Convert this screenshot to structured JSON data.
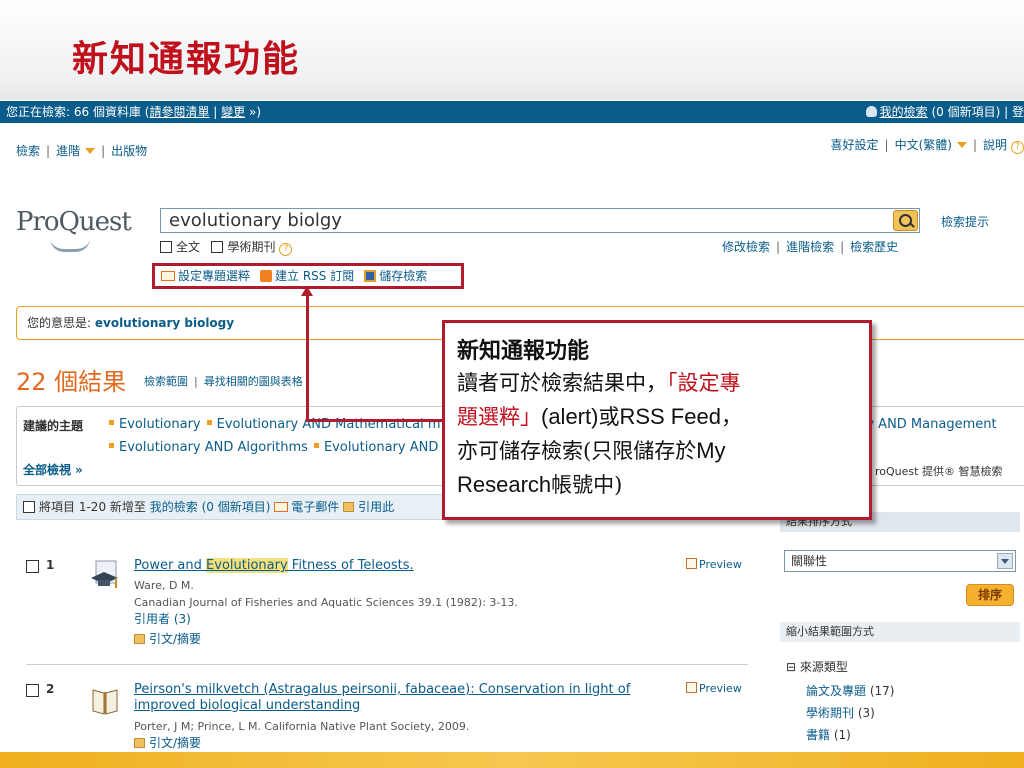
{
  "slide": {
    "title": "新知通報功能"
  },
  "status": {
    "searching": "您正在檢索: 66 個資料庫 (",
    "view_list": "請參閱清單",
    "sep": " | ",
    "change": "變更",
    "end": " »)",
    "my_search": "我的檢索",
    "new_items": " (0 個新項目) | 登"
  },
  "nav": {
    "search": "檢索",
    "advanced": "進階",
    "publications": "出版物",
    "preferences": "喜好設定",
    "language": "中文(繁體)",
    "help": "說明"
  },
  "logo": "ProQuest",
  "search": {
    "query": "evolutionary biolgy",
    "tips": "檢索提示",
    "full_text": "全文",
    "scholarly": "學術期刊",
    "modify": "修改檢索",
    "advanced": "進階檢索",
    "history": "檢索歷史"
  },
  "alert_tools": {
    "set_alert": "設定專題選粹",
    "rss": "建立 RSS 訂閱",
    "save": "儲存檢索"
  },
  "did_you_mean": {
    "label": "您的意思是: ",
    "suggestion": "evolutionary biology"
  },
  "results": {
    "count": "22 個結果",
    "scope": "檢索範圍",
    "related": "尋找相關的圖與表格"
  },
  "suggested": {
    "label": "建議的主題",
    "row1": [
      "Evolutionary",
      "Evolutionary AND Mathematical m"
    ],
    "row2": [
      "Evolutionary AND Algorithms",
      "Evolutionary AND"
    ],
    "right1": "ry AND Management",
    "view_all": "全部檢視 »",
    "provided": "roQuest 提供® 智慧檢索"
  },
  "actions": {
    "items": "將項目",
    "range": "1-20 新增至",
    "my_search": "我的檢索",
    "new_items": "(0 個新項目)",
    "email": "電子郵件",
    "cite": "引用此"
  },
  "right_panel": {
    "sort_head": "結果排序方式",
    "sort_value": "關聯性",
    "sort_button": "排序",
    "narrow_head": "縮小結果範圍方式",
    "source_type": "⊟ 來源類型",
    "sources": [
      {
        "name": "論文及專題",
        "count": "(17)"
      },
      {
        "name": "學術期刊",
        "count": "(3)"
      },
      {
        "name": "書籍",
        "count": "(1)"
      }
    ]
  },
  "result_items": [
    {
      "num": "1",
      "title_pre": "Power and ",
      "title_hl": "Evolutionary",
      "title_post": " Fitness of Teleosts.",
      "preview": "Preview",
      "author": "Ware, D M.",
      "source": "Canadian Journal of Fisheries and Aquatic Sciences 39.1 (1982): 3-13.",
      "cited": "引用者 (3)",
      "abstract": "引文/摘要"
    },
    {
      "num": "2",
      "title_line1": "Peirson's milkvetch (Astragalus peirsonii, fabaceae): Conservation in light of",
      "title_line2": "improved biological understanding",
      "preview": "Preview",
      "source": "Porter, J M; Prince, L M. California Native Plant Society, 2009.",
      "abstract": "引文/摘要"
    }
  ],
  "callout": {
    "title": "新知通報功能",
    "line1_a": "讀者可於檢索結果中，",
    "line1_b": "「設定專",
    "line2_a": "題選粹」",
    "line2_b": "(alert)",
    "line2_c": "或",
    "line2_d": "RSS Feed",
    "line2_e": "，",
    "line3_a": "亦可儲存檢索(只限儲存於",
    "line3_b": "My",
    "line4_a": "Research",
    "line4_b": "帳號中)"
  },
  "colors": {
    "accent_red": "#c0101c",
    "link_blue": "#0a5c8a",
    "status_bar": "#0a5c8a",
    "orange": "#e06a20"
  }
}
